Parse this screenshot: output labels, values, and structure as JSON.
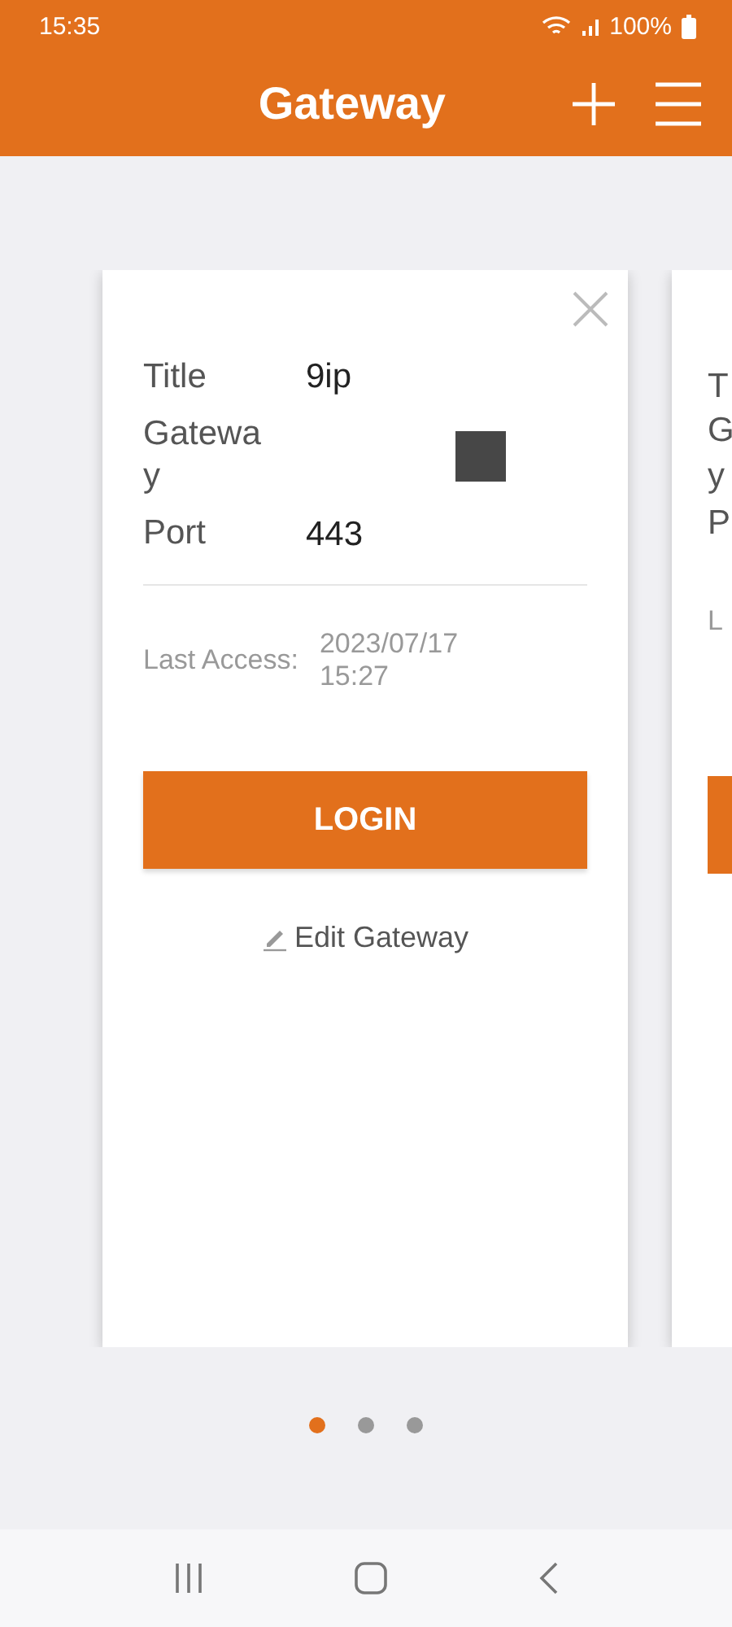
{
  "status_bar": {
    "time": "15:35",
    "battery": "100%"
  },
  "app_bar": {
    "title": "Gateway"
  },
  "card": {
    "fields": [
      {
        "label": "Title",
        "value": "9ip",
        "kind": "text"
      },
      {
        "label": "Gateway",
        "kind": "square"
      },
      {
        "label": "Port",
        "value": "443",
        "kind": "text"
      }
    ],
    "last_access_label": "Last Access:",
    "last_access_value": "2023/07/17 15:27",
    "login_button": "LOGIN",
    "edit_link": "Edit Gateway"
  },
  "next_card": {
    "labels": [
      "T",
      "G",
      "y",
      "P"
    ],
    "last_access_label": "L"
  },
  "pager": [
    {
      "selected": true
    },
    {
      "selected": false
    },
    {
      "selected": false
    }
  ]
}
